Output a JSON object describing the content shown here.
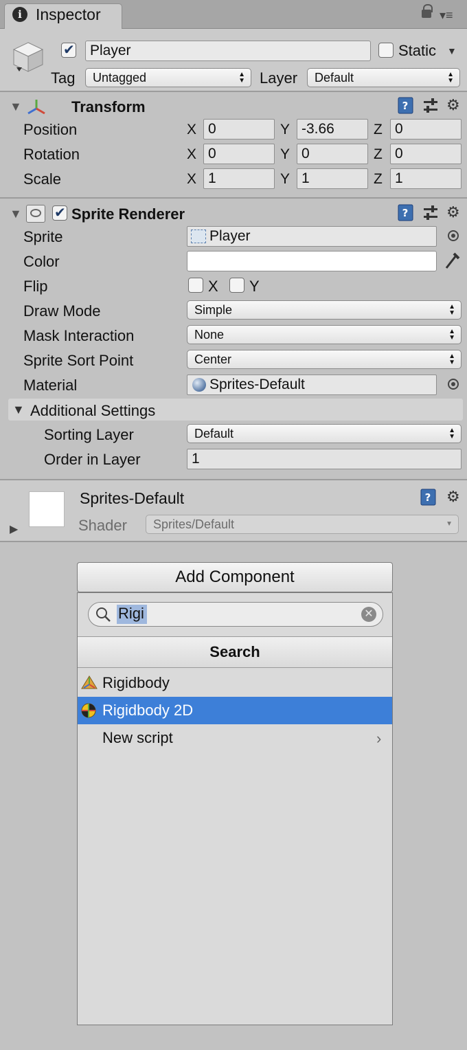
{
  "tab": {
    "title": "Inspector",
    "icon": "info-icon"
  },
  "gameobject": {
    "name": "Player",
    "active": true,
    "static_label": "Static",
    "static": false,
    "tag_label": "Tag",
    "tag_value": "Untagged",
    "layer_label": "Layer",
    "layer_value": "Default"
  },
  "transform": {
    "title": "Transform",
    "rows": [
      {
        "label": "Position",
        "x": "0",
        "y": "-3.66",
        "z": "0"
      },
      {
        "label": "Rotation",
        "x": "0",
        "y": "0",
        "z": "0"
      },
      {
        "label": "Scale",
        "x": "1",
        "y": "1",
        "z": "1"
      }
    ],
    "axis": {
      "x": "X",
      "y": "Y",
      "z": "Z"
    }
  },
  "sprite_renderer": {
    "title": "Sprite Renderer",
    "enabled": true,
    "sprite_label": "Sprite",
    "sprite_value": "Player",
    "color_label": "Color",
    "color_value": "#ffffff",
    "flip_label": "Flip",
    "flip_x": "X",
    "flip_y": "Y",
    "draw_mode_label": "Draw Mode",
    "draw_mode_value": "Simple",
    "mask_label": "Mask Interaction",
    "mask_value": "None",
    "sort_point_label": "Sprite Sort Point",
    "sort_point_value": "Center",
    "material_label": "Material",
    "material_value": "Sprites-Default",
    "additional_label": "Additional Settings",
    "sorting_layer_label": "Sorting Layer",
    "sorting_layer_value": "Default",
    "order_label": "Order in Layer",
    "order_value": "1"
  },
  "material": {
    "name": "Sprites-Default",
    "shader_label": "Shader",
    "shader_value": "Sprites/Default"
  },
  "add_component": {
    "button_label": "Add Component",
    "search_value": "Rigi",
    "header": "Search",
    "items": [
      {
        "label": "Rigidbody",
        "icon": "rigidbody-icon",
        "selected": false
      },
      {
        "label": "Rigidbody 2D",
        "icon": "rigidbody2d-icon",
        "selected": true
      },
      {
        "label": "New script",
        "icon": "",
        "selected": false,
        "submenu": true
      }
    ]
  },
  "colors": {
    "selection": "#3d7fd8",
    "panel": "#c2c2c2",
    "header": "#cbcbcb"
  }
}
